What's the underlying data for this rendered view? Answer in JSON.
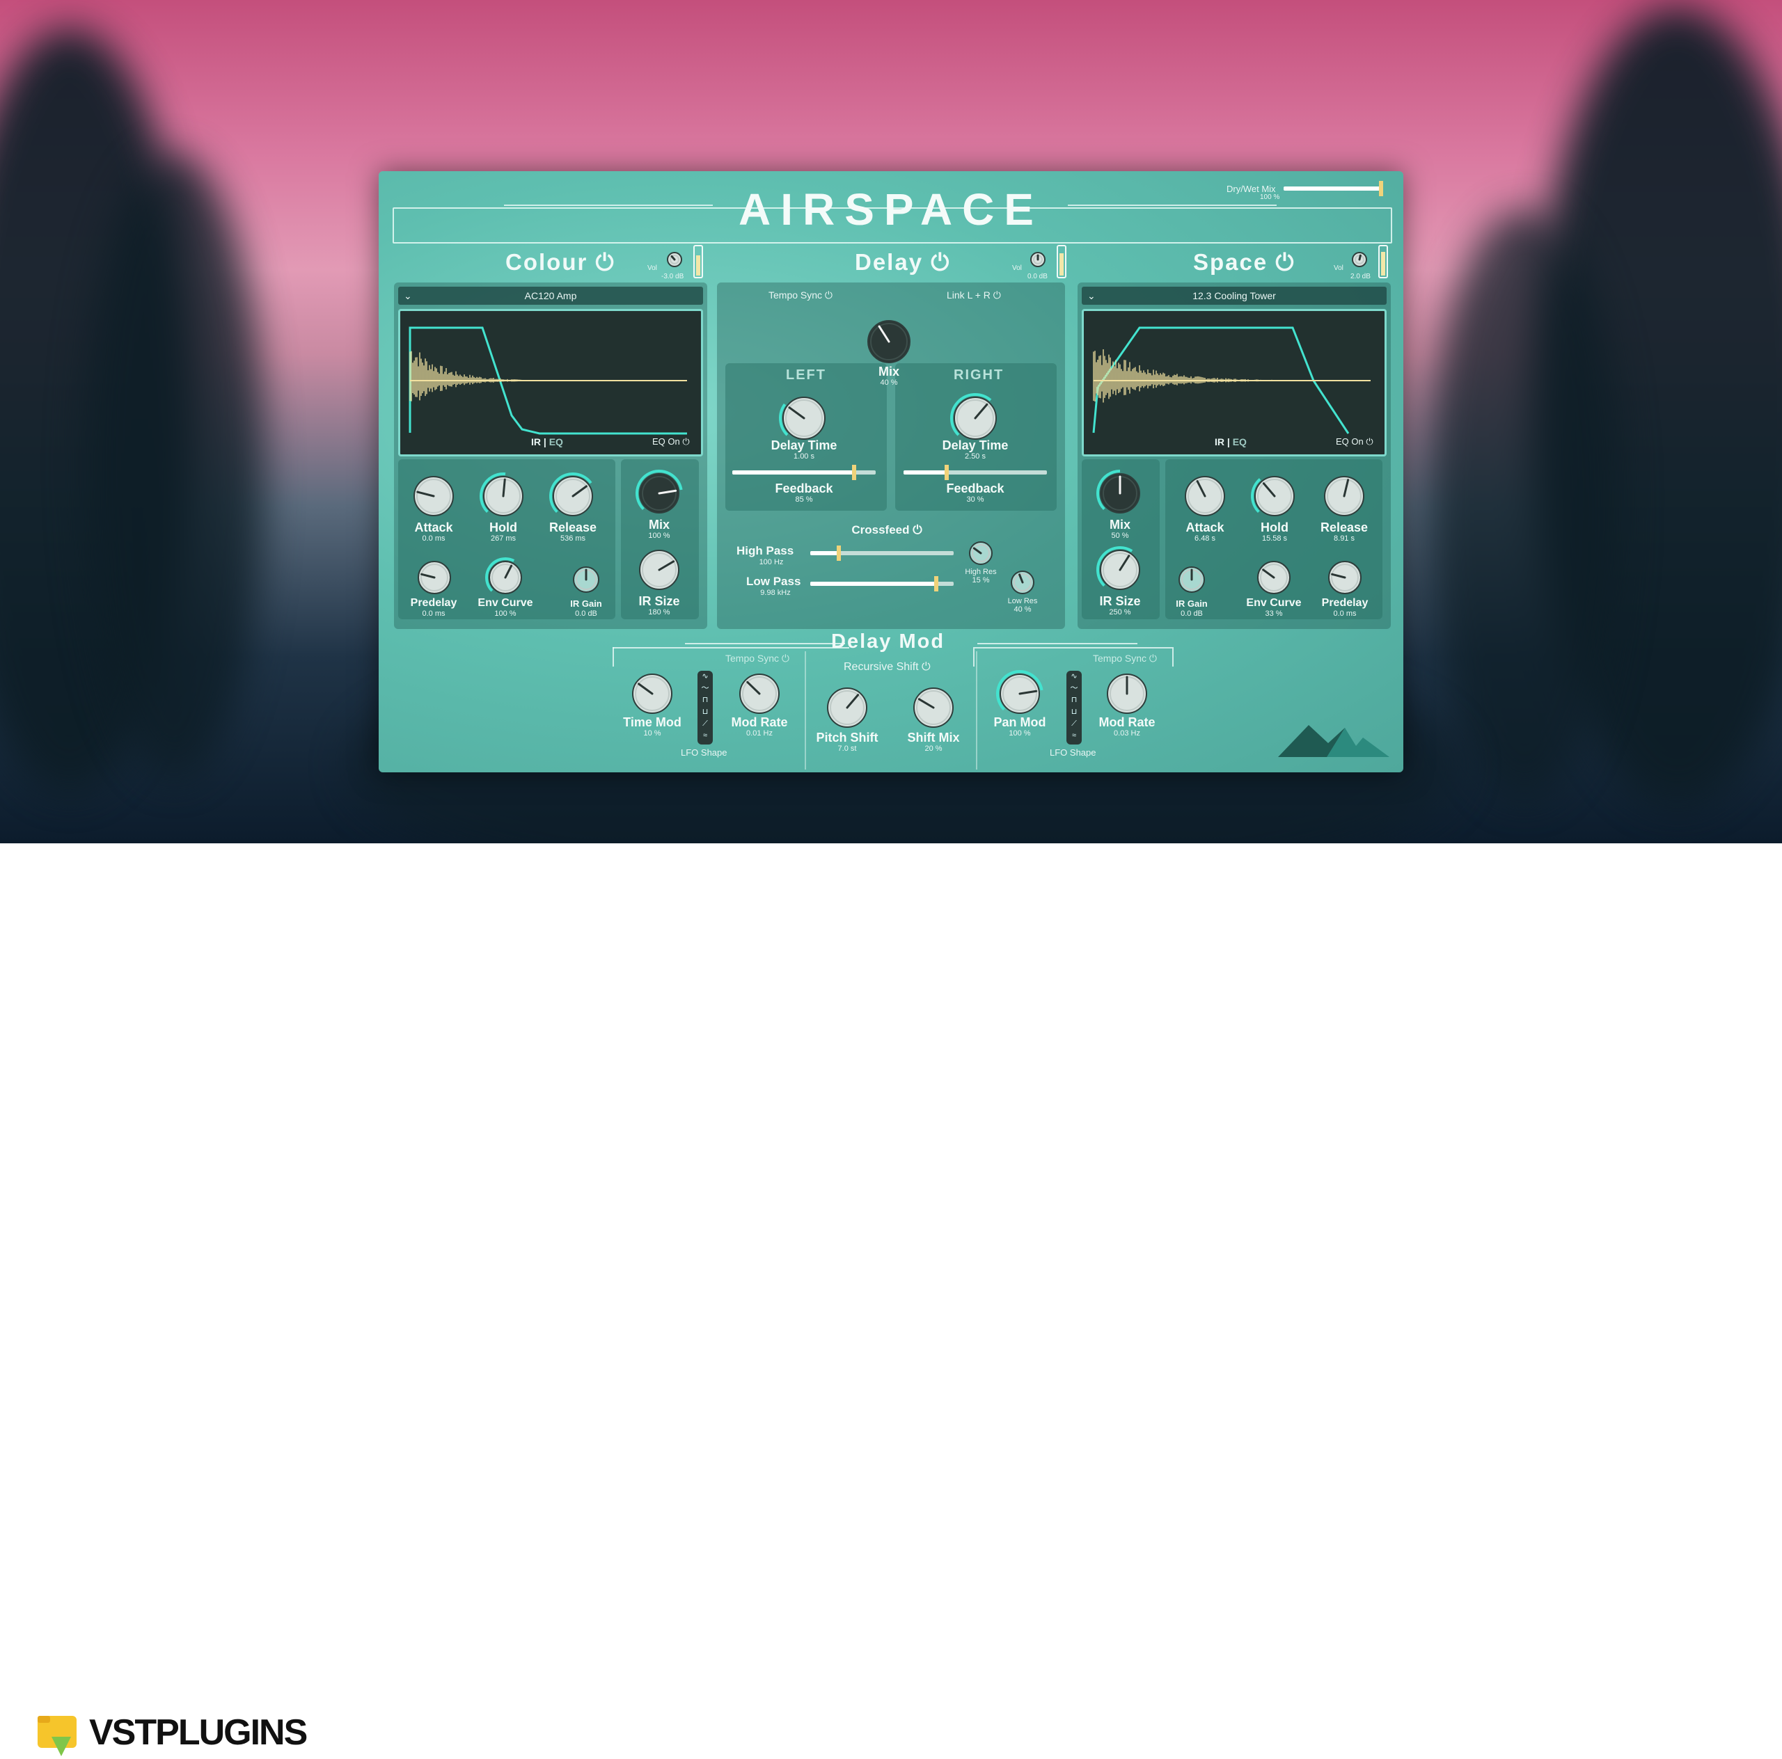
{
  "plugin": {
    "title": "AIRSPACE",
    "dry_wet": {
      "label": "Dry/Wet Mix",
      "value": "100 %",
      "level": 1.0
    }
  },
  "colour": {
    "title": "Colour",
    "vol": {
      "label": "Vol",
      "value": "-3.0 dB",
      "level": 0.72
    },
    "preset": "AC120 Amp",
    "ir_label": "IR",
    "eq_label": "EQ",
    "eq_on": "EQ On",
    "knobs": {
      "attack": {
        "label": "Attack",
        "value": "0.0 ms"
      },
      "hold": {
        "label": "Hold",
        "value": "267 ms"
      },
      "release": {
        "label": "Release",
        "value": "536 ms"
      },
      "mix": {
        "label": "Mix",
        "value": "100 %"
      },
      "predelay": {
        "label": "Predelay",
        "value": "0.0 ms"
      },
      "env_curve": {
        "label": "Env Curve",
        "value": "100 %"
      },
      "ir_gain": {
        "label": "IR Gain",
        "value": "0.0 dB"
      },
      "ir_size": {
        "label": "IR Size",
        "value": "180 %"
      }
    }
  },
  "delay": {
    "title": "Delay",
    "vol": {
      "label": "Vol",
      "value": "0.0 dB",
      "level": 0.8
    },
    "tempo_sync": "Tempo Sync",
    "link": "Link L + R",
    "mix": {
      "label": "Mix",
      "value": "40 %"
    },
    "left": {
      "label": "LEFT",
      "time_label": "Delay Time",
      "time_value": "1.00 s",
      "fb_label": "Feedback",
      "fb_value": "85 %",
      "fb_level": 0.85
    },
    "right": {
      "label": "RIGHT",
      "time_label": "Delay Time",
      "time_value": "2.50 s",
      "fb_label": "Feedback",
      "fb_value": "30 %",
      "fb_level": 0.3
    },
    "crossfeed": "Crossfeed",
    "high_pass": {
      "label": "High Pass",
      "value": "100 Hz",
      "level": 0.2
    },
    "low_pass": {
      "label": "Low Pass",
      "value": "9.98 kHz",
      "level": 0.88
    },
    "high_res": {
      "label": "High Res",
      "value": "15 %"
    },
    "low_res": {
      "label": "Low Res",
      "value": "40 %"
    }
  },
  "space": {
    "title": "Space",
    "vol": {
      "label": "Vol",
      "value": "2.0 dB",
      "level": 0.85
    },
    "preset": "12.3 Cooling Tower",
    "ir_label": "IR",
    "eq_label": "EQ",
    "eq_on": "EQ On",
    "knobs": {
      "mix": {
        "label": "Mix",
        "value": "50 %"
      },
      "attack": {
        "label": "Attack",
        "value": "6.48 s"
      },
      "hold": {
        "label": "Hold",
        "value": "15.58 s"
      },
      "release": {
        "label": "Release",
        "value": "8.91 s"
      },
      "ir_size": {
        "label": "IR Size",
        "value": "250 %"
      },
      "ir_gain": {
        "label": "IR Gain",
        "value": "0.0 dB"
      },
      "env_curve": {
        "label": "Env Curve",
        "value": "33 %"
      },
      "predelay": {
        "label": "Predelay",
        "value": "0.0 ms"
      }
    }
  },
  "delay_mod": {
    "title": "Delay Mod",
    "tempo_sync_left": "Tempo Sync",
    "tempo_sync_right": "Tempo Sync",
    "recursive_shift": "Recursive Shift",
    "lfo_shape_left": "LFO Shape",
    "lfo_shape_right": "LFO Shape",
    "time_mod": {
      "label": "Time Mod",
      "value": "10 %"
    },
    "mod_rate_left": {
      "label": "Mod Rate",
      "value": "0.01 Hz"
    },
    "pitch_shift": {
      "label": "Pitch Shift",
      "value": "7.0 st"
    },
    "shift_mix": {
      "label": "Shift Mix",
      "value": "20 %"
    },
    "pan_mod": {
      "label": "Pan Mod",
      "value": "100 %"
    },
    "mod_rate_right": {
      "label": "Mod Rate",
      "value": "0.03 Hz"
    }
  },
  "brand": {
    "text": "VSTPLUGINS"
  },
  "colors": {
    "accent": "#43e3cf",
    "teal": "#5fbfb0",
    "waveform": "#f2e1a0"
  }
}
